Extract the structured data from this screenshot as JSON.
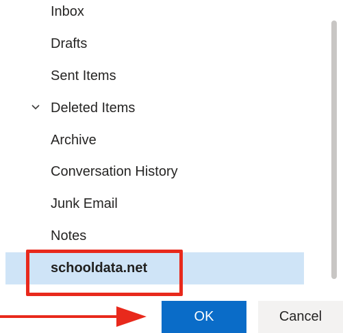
{
  "folders": [
    {
      "label": "Inbox"
    },
    {
      "label": "Drafts"
    },
    {
      "label": "Sent Items"
    },
    {
      "label": "Deleted Items",
      "expanded": true
    },
    {
      "label": "Archive"
    },
    {
      "label": "Conversation History"
    },
    {
      "label": "Junk Email"
    },
    {
      "label": "Notes"
    },
    {
      "label": "schooldata.net",
      "selected": true
    }
  ],
  "buttons": {
    "ok_label": "OK",
    "cancel_label": "Cancel"
  },
  "colors": {
    "accent": "#0a6cc8",
    "selection": "#cfe4f7",
    "annotation": "#e8291c"
  }
}
